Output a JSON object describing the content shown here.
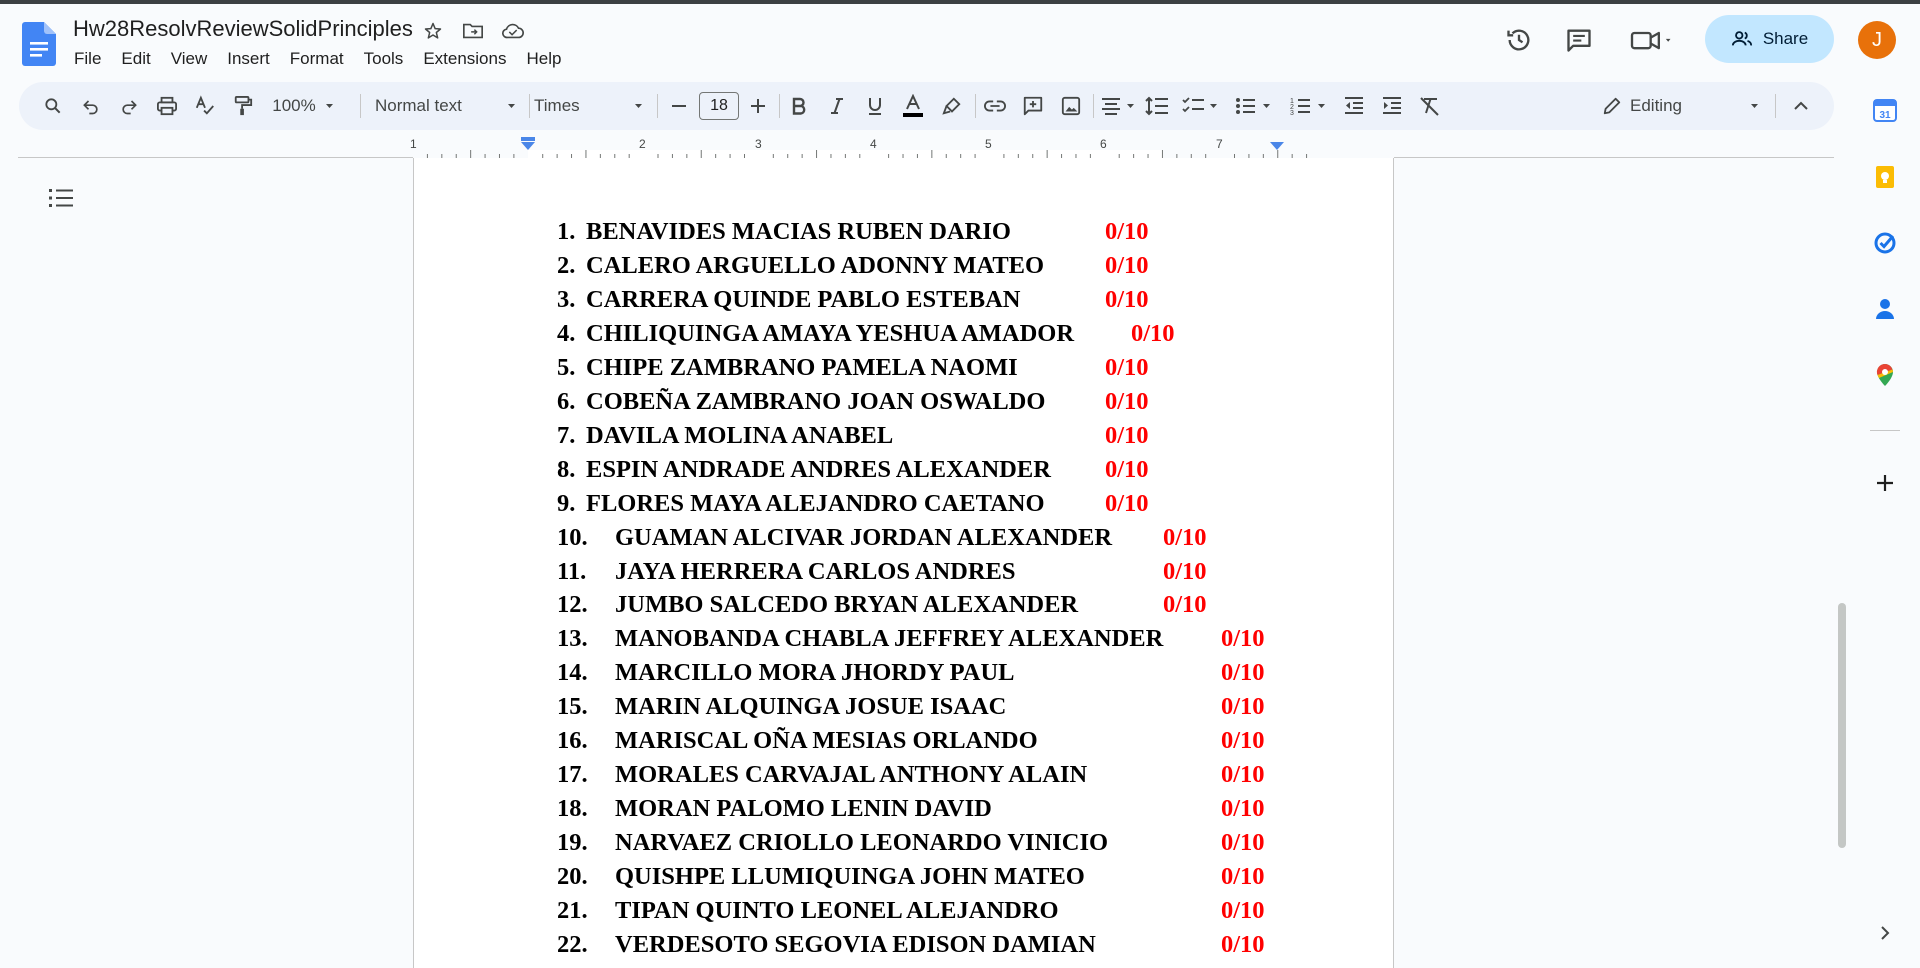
{
  "document": {
    "title": "Hw28ResolvReviewSolidPrinciples"
  },
  "menu": [
    "File",
    "Edit",
    "View",
    "Insert",
    "Format",
    "Tools",
    "Extensions",
    "Help"
  ],
  "header": {
    "share_label": "Share",
    "avatar_letter": "J"
  },
  "toolbar": {
    "zoom": "100%",
    "style": "Normal text",
    "font": "Times",
    "font_size": "18",
    "mode": "Editing"
  },
  "ruler": {
    "labels": [
      "1",
      "1",
      "2",
      "3",
      "4",
      "5",
      "6",
      "7"
    ]
  },
  "students": [
    {
      "num": "1.",
      "name": "BENAVIDES MACIAS RUBEN DARIO",
      "score": "0/10"
    },
    {
      "num": "2.",
      "name": "CALERO ARGUELLO ADONNY MATEO",
      "score": "0/10"
    },
    {
      "num": "3.",
      "name": "CARRERA QUINDE PABLO ESTEBAN",
      "score": "0/10"
    },
    {
      "num": "4.",
      "name": "CHILIQUINGA AMAYA YESHUA AMADOR",
      "score": "0/10"
    },
    {
      "num": "5.",
      "name": "CHIPE ZAMBRANO PAMELA NAOMI",
      "score": "0/10"
    },
    {
      "num": "6.",
      "name": "COBEÑA ZAMBRANO JOAN OSWALDO",
      "score": "0/10"
    },
    {
      "num": "7.",
      "name": "DAVILA MOLINA ANABEL",
      "score": "0/10"
    },
    {
      "num": "8.",
      "name": "ESPIN ANDRADE ANDRES ALEXANDER",
      "score": "0/10"
    },
    {
      "num": "9.",
      "name": "FLORES MAYA ALEJANDRO CAETANO",
      "score": "0/10"
    },
    {
      "num": "10.",
      "name": "GUAMAN ALCIVAR JORDAN ALEXANDER",
      "score": "0/10"
    },
    {
      "num": "11.",
      "name": "JAYA HERRERA CARLOS ANDRES",
      "score": "0/10"
    },
    {
      "num": "12.",
      "name": "JUMBO SALCEDO BRYAN ALEXANDER",
      "score": "0/10"
    },
    {
      "num": "13.",
      "name": "MANOBANDA CHABLA JEFFREY ALEXANDER",
      "score": "0/10"
    },
    {
      "num": "14.",
      "name": "MARCILLO MORA JHORDY PAUL",
      "score": "0/10"
    },
    {
      "num": "15.",
      "name": "MARIN ALQUINGA JOSUE ISAAC",
      "score": "0/10"
    },
    {
      "num": "16.",
      "name": "MARISCAL OÑA MESIAS ORLANDO",
      "score": "0/10"
    },
    {
      "num": "17.",
      "name": "MORALES CARVAJAL ANTHONY ALAIN",
      "score": "0/10"
    },
    {
      "num": "18.",
      "name": "MORAN PALOMO LENIN DAVID",
      "score": "0/10"
    },
    {
      "num": "19.",
      "name": "NARVAEZ CRIOLLO LEONARDO VINICIO",
      "score": "0/10"
    },
    {
      "num": "20.",
      "name": "QUISHPE LLUMIQUINGA JOHN MATEO",
      "score": "0/10"
    },
    {
      "num": "21.",
      "name": "TIPAN QUINTO LEONEL ALEJANDRO",
      "score": "0/10"
    },
    {
      "num": "22.",
      "name": "VERDESOTO SEGOVIA EDISON DAMIAN",
      "score": "0/10"
    }
  ],
  "colors": {
    "score": "#ff0000",
    "share_bg": "#c2e7ff",
    "avatar_bg": "#e8710a",
    "toolbar_bg": "#edf2fa"
  },
  "side_panel": [
    "calendar-icon",
    "keep-icon",
    "tasks-icon",
    "contacts-icon",
    "maps-icon",
    "add-icon",
    "chevron-right-icon"
  ]
}
